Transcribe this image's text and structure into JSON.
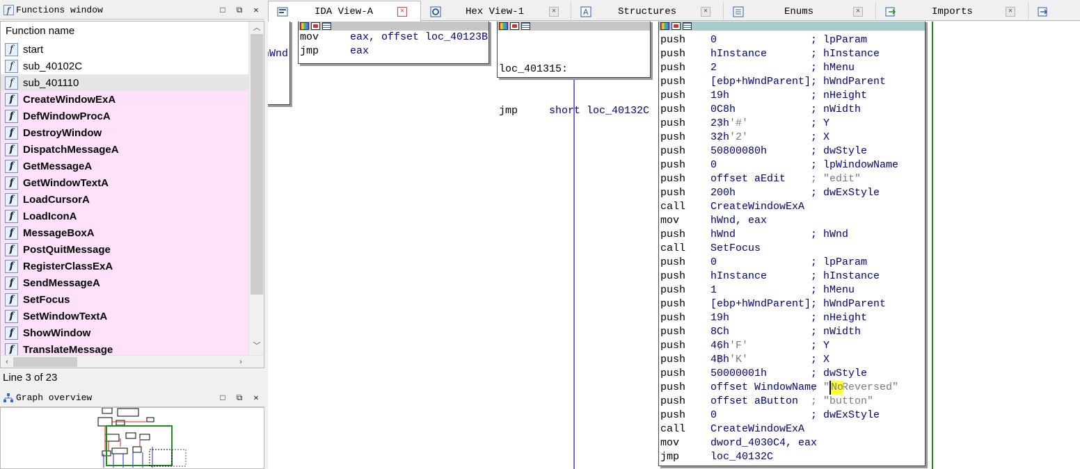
{
  "functions_window": {
    "title": "Functions window",
    "column_header": "Function name",
    "items": [
      {
        "name": "start",
        "style": "normal"
      },
      {
        "name": "sub_40102C",
        "style": "normal"
      },
      {
        "name": "sub_401110",
        "style": "selected"
      },
      {
        "name": "CreateWindowExA",
        "style": "import"
      },
      {
        "name": "DefWindowProcA",
        "style": "import"
      },
      {
        "name": "DestroyWindow",
        "style": "import"
      },
      {
        "name": "DispatchMessageA",
        "style": "import"
      },
      {
        "name": "GetMessageA",
        "style": "import"
      },
      {
        "name": "GetWindowTextA",
        "style": "import"
      },
      {
        "name": "LoadCursorA",
        "style": "import"
      },
      {
        "name": "LoadIconA",
        "style": "import"
      },
      {
        "name": "MessageBoxA",
        "style": "import"
      },
      {
        "name": "PostQuitMessage",
        "style": "import"
      },
      {
        "name": "RegisterClassExA",
        "style": "import"
      },
      {
        "name": "SendMessageA",
        "style": "import"
      },
      {
        "name": "SetFocus",
        "style": "import"
      },
      {
        "name": "SetWindowTextA",
        "style": "import"
      },
      {
        "name": "ShowWindow",
        "style": "import"
      },
      {
        "name": "TranslateMessage",
        "style": "import"
      }
    ],
    "status": "Line 3 of 23",
    "function_icon_glyph": "f",
    "import_row_color": "#ffe1fb"
  },
  "graph_overview": {
    "title": "Graph overview"
  },
  "panel_buttons": {
    "minimize": "□",
    "float": "⧉",
    "close": "✕"
  },
  "tabs": [
    {
      "label": "IDA View-A",
      "active": true
    },
    {
      "label": "Hex View-1",
      "active": false
    },
    {
      "label": "Structures",
      "active": false
    },
    {
      "label": "Enums",
      "active": false
    },
    {
      "label": "Imports",
      "active": false
    }
  ],
  "nodes": {
    "left_partial": {
      "text": "hWnd"
    },
    "n1": {
      "lines": [
        {
          "m": "mov",
          "o": "eax, offset loc_40123B"
        },
        {
          "m": "jmp",
          "o": "eax"
        }
      ]
    },
    "n2": {
      "label": "loc_401315:",
      "lines": [
        {
          "m": "jmp",
          "o": "short loc_40132C"
        }
      ]
    },
    "main": {
      "lines": [
        {
          "m": "push",
          "o": "0",
          "c": "; lpParam"
        },
        {
          "m": "push",
          "o": "hInstance",
          "c": "; hInstance"
        },
        {
          "m": "push",
          "o": "2",
          "c": "; hMenu"
        },
        {
          "m": "push",
          "o": "[ebp+hWndParent]",
          "c": "; hWndParent"
        },
        {
          "m": "push",
          "o": "19h",
          "c": "; nHeight"
        },
        {
          "m": "push",
          "o": "0C8h",
          "c": "; nWidth"
        },
        {
          "m": "push",
          "o": "23h",
          "oc": " ; '#'",
          "c": "; Y"
        },
        {
          "m": "push",
          "o": "32h",
          "oc": " ; '2'",
          "c": "; X"
        },
        {
          "m": "push",
          "o": "50800080h",
          "c": "; dwStyle"
        },
        {
          "m": "push",
          "o": "0",
          "c": "; lpWindowName"
        },
        {
          "m": "push",
          "o": "offset aEdit",
          "c": "; \"edit\""
        },
        {
          "m": "push",
          "o": "200h",
          "c": "; dwExStyle"
        },
        {
          "m": "call",
          "o": "CreateWindowExA"
        },
        {
          "m": "mov",
          "o": "hWnd, eax"
        },
        {
          "m": "push",
          "o": "hWnd",
          "c": "; hWnd"
        },
        {
          "m": "call",
          "o": "SetFocus"
        },
        {
          "m": "push",
          "o": "0",
          "c": "; lpParam"
        },
        {
          "m": "push",
          "o": "hInstance",
          "c": "; hInstance"
        },
        {
          "m": "push",
          "o": "1",
          "c": "; hMenu"
        },
        {
          "m": "push",
          "o": "[ebp+hWndParent]",
          "c": "; hWndParent"
        },
        {
          "m": "push",
          "o": "19h",
          "c": "; nHeight"
        },
        {
          "m": "push",
          "o": "8Ch",
          "c": "; nWidth"
        },
        {
          "m": "push",
          "o": "46h",
          "oc": " ; 'F'",
          "c": "; Y"
        },
        {
          "m": "push",
          "o": "4Bh",
          "oc": " ; 'K'",
          "c": "; X"
        },
        {
          "m": "push",
          "o": "50000001h",
          "c": "; dwStyle"
        },
        {
          "m": "push",
          "o": "offset WindowName",
          "c": "; \"Not Reversed\""
        },
        {
          "m": "push",
          "o": "offset aButton",
          "c": "; \"button\""
        },
        {
          "m": "push",
          "o": "0",
          "c": "; dwExStyle"
        },
        {
          "m": "call",
          "o": "CreateWindowExA"
        },
        {
          "m": "mov",
          "o": "dword_4030C4, eax"
        },
        {
          "m": "jmp",
          "o": "loc_40132C"
        }
      ]
    }
  },
  "colors": {
    "operand": "#000080",
    "highlight": "#ffff3c",
    "node_header": "#a6cccc",
    "edge_blue": "#3f3fd8",
    "edge_green": "#1a8f1a"
  }
}
